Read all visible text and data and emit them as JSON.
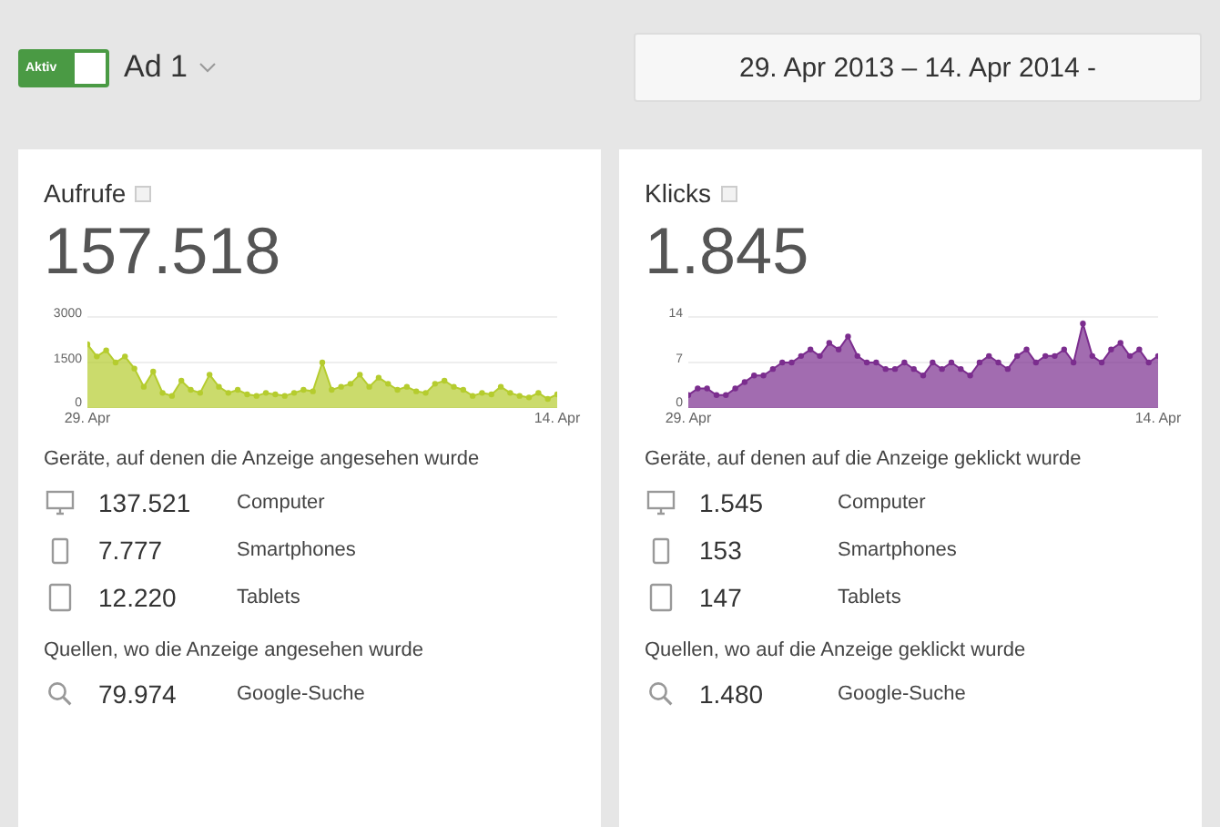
{
  "toggle": {
    "label": "Aktiv",
    "on": true
  },
  "ad_name": "Ad 1",
  "date_range": "29. Apr 2013 – 14. Apr 2014 -",
  "cards": [
    {
      "title": "Aufrufe",
      "total": "157.518",
      "chart_data": {
        "type": "area",
        "ylim": [
          0,
          3000
        ],
        "yticks": [
          0,
          1500,
          3000
        ],
        "categories": [
          "29. Apr",
          null,
          null,
          null,
          null,
          null,
          null,
          null,
          null,
          null,
          null,
          null,
          null,
          null,
          null,
          null,
          null,
          null,
          null,
          null,
          null,
          null,
          null,
          null,
          null,
          null,
          null,
          null,
          null,
          null,
          null,
          null,
          null,
          null,
          null,
          null,
          null,
          null,
          null,
          null,
          null,
          null,
          null,
          null,
          null,
          null,
          null,
          null,
          null,
          null,
          "14. Apr"
        ],
        "series": [
          {
            "color": "#b5cc2e",
            "values": [
              2100,
              1700,
              1900,
              1500,
              1700,
              1300,
              700,
              1200,
              500,
              400,
              900,
              600,
              500,
              1100,
              700,
              500,
              600,
              450,
              400,
              500,
              450,
              400,
              500,
              600,
              550,
              1500,
              600,
              700,
              800,
              1100,
              700,
              1000,
              800,
              600,
              700,
              550,
              500,
              800,
              900,
              700,
              600,
              400,
              500,
              450,
              700,
              500,
              400,
              350,
              500,
              300,
              450
            ]
          }
        ]
      },
      "devices_heading": "Geräte, auf denen die Anzeige angesehen wurde",
      "devices": [
        {
          "kind": "computer",
          "value": "137.521",
          "label": "Computer"
        },
        {
          "kind": "smartphone",
          "value": "7.777",
          "label": "Smartphones"
        },
        {
          "kind": "tablet",
          "value": "12.220",
          "label": "Tablets"
        }
      ],
      "sources_heading": "Quellen, wo die Anzeige angesehen wurde",
      "sources": [
        {
          "kind": "search",
          "value": "79.974",
          "label": "Google-Suche"
        }
      ]
    },
    {
      "title": "Klicks",
      "total": "1.845",
      "chart_data": {
        "type": "area",
        "ylim": [
          0,
          14
        ],
        "yticks": [
          0,
          7,
          14
        ],
        "categories": [
          "29. Apr",
          null,
          null,
          null,
          null,
          null,
          null,
          null,
          null,
          null,
          null,
          null,
          null,
          null,
          null,
          null,
          null,
          null,
          null,
          null,
          null,
          null,
          null,
          null,
          null,
          null,
          null,
          null,
          null,
          null,
          null,
          null,
          null,
          null,
          null,
          null,
          null,
          null,
          null,
          null,
          null,
          null,
          null,
          null,
          null,
          null,
          null,
          null,
          null,
          null,
          "14. Apr"
        ],
        "series": [
          {
            "color": "#7b2d8e",
            "values": [
              2,
              3,
              3,
              2,
              2,
              3,
              4,
              5,
              5,
              6,
              7,
              7,
              8,
              9,
              8,
              10,
              9,
              11,
              8,
              7,
              7,
              6,
              6,
              7,
              6,
              5,
              7,
              6,
              7,
              6,
              5,
              7,
              8,
              7,
              6,
              8,
              9,
              7,
              8,
              8,
              9,
              7,
              13,
              8,
              7,
              9,
              10,
              8,
              9,
              7,
              8
            ]
          }
        ]
      },
      "devices_heading": "Geräte, auf denen auf die Anzeige geklickt wurde",
      "devices": [
        {
          "kind": "computer",
          "value": "1.545",
          "label": "Computer"
        },
        {
          "kind": "smartphone",
          "value": "153",
          "label": "Smartphones"
        },
        {
          "kind": "tablet",
          "value": "147",
          "label": "Tablets"
        }
      ],
      "sources_heading": "Quellen, wo auf die Anzeige geklickt wurde",
      "sources": [
        {
          "kind": "search",
          "value": "1.480",
          "label": "Google-Suche"
        }
      ]
    }
  ]
}
